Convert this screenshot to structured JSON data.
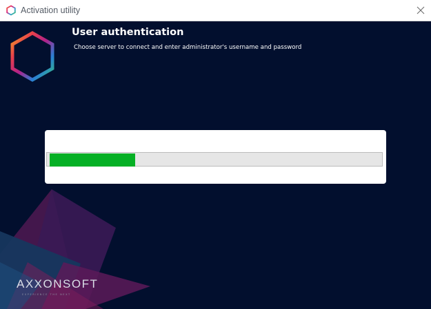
{
  "window": {
    "title": "Activation utility",
    "close_icon": "close-icon",
    "app_icon": "hexagon-logo-icon"
  },
  "header": {
    "title": "User authentication",
    "subtitle": "Choose server to connect and enter administrator's username and password"
  },
  "progress": {
    "value": 0.26,
    "color": "#06b025"
  },
  "branding": {
    "logo_text": "AXXONSOFT",
    "tagline": "EXPERIENCE THE NEXT"
  },
  "colors": {
    "background": "#020f2e",
    "panel": "#ffffff",
    "progress_track": "#e6e6e6"
  }
}
